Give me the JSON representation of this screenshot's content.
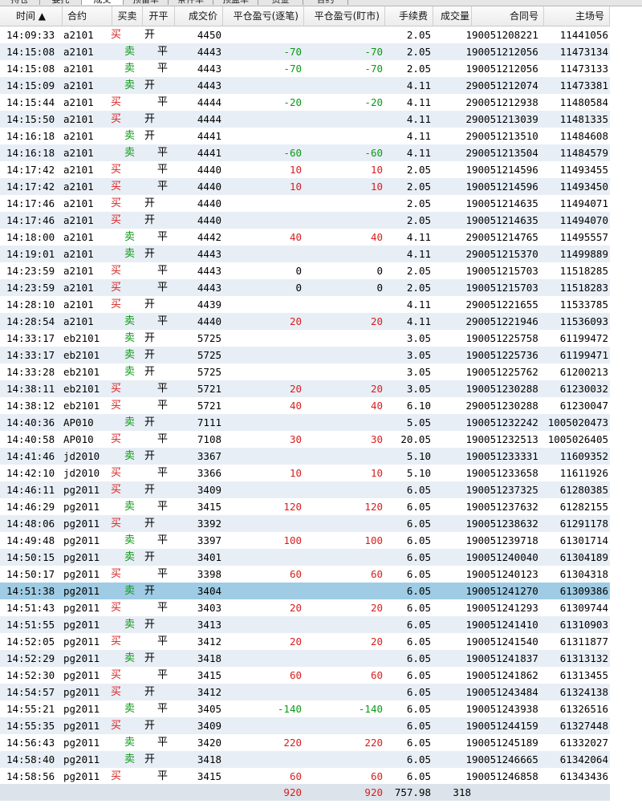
{
  "tabs": [
    "持仓",
    "委托",
    "成交",
    "预留单",
    "条件单",
    "预盈单",
    "资金",
    "合约"
  ],
  "active_tab": 2,
  "columns": {
    "time": "时间 ▲",
    "contract": "合约",
    "side": "买卖",
    "oc": "开平",
    "price": "成交价",
    "pnl_each": "平仓盈亏(逐笔)",
    "pnl_day": "平仓盈亏(盯市)",
    "fee": "手续费",
    "vol": "成交量",
    "order_no": "合同号",
    "deal_no": "主场号"
  },
  "rows": [
    {
      "time": "14:09:33",
      "contract": "a2101",
      "side": "买",
      "oc": "开",
      "price": "4450",
      "pnl_each": "",
      "pnl_day": "",
      "fee": "2.05",
      "vol": "1",
      "order_no": "90051208221",
      "deal_no": "11441056"
    },
    {
      "time": "14:15:08",
      "contract": "a2101",
      "side": "卖",
      "oc": "平",
      "price": "4443",
      "pnl_each": "-70",
      "pnl_day": "-70",
      "fee": "2.05",
      "vol": "1",
      "order_no": "90051212056",
      "deal_no": "11473134"
    },
    {
      "time": "14:15:08",
      "contract": "a2101",
      "side": "卖",
      "oc": "平",
      "price": "4443",
      "pnl_each": "-70",
      "pnl_day": "-70",
      "fee": "2.05",
      "vol": "1",
      "order_no": "90051212056",
      "deal_no": "11473133"
    },
    {
      "time": "14:15:09",
      "contract": "a2101",
      "side": "卖",
      "oc": "开",
      "price": "4443",
      "pnl_each": "",
      "pnl_day": "",
      "fee": "4.11",
      "vol": "2",
      "order_no": "90051212074",
      "deal_no": "11473381"
    },
    {
      "time": "14:15:44",
      "contract": "a2101",
      "side": "买",
      "oc": "平",
      "price": "4444",
      "pnl_each": "-20",
      "pnl_day": "-20",
      "fee": "4.11",
      "vol": "2",
      "order_no": "90051212938",
      "deal_no": "11480584"
    },
    {
      "time": "14:15:50",
      "contract": "a2101",
      "side": "买",
      "oc": "开",
      "price": "4444",
      "pnl_each": "",
      "pnl_day": "",
      "fee": "4.11",
      "vol": "2",
      "order_no": "90051213039",
      "deal_no": "11481335"
    },
    {
      "time": "14:16:18",
      "contract": "a2101",
      "side": "卖",
      "oc": "开",
      "price": "4441",
      "pnl_each": "",
      "pnl_day": "",
      "fee": "4.11",
      "vol": "2",
      "order_no": "90051213510",
      "deal_no": "11484608"
    },
    {
      "time": "14:16:18",
      "contract": "a2101",
      "side": "卖",
      "oc": "平",
      "price": "4441",
      "pnl_each": "-60",
      "pnl_day": "-60",
      "fee": "4.11",
      "vol": "2",
      "order_no": "90051213504",
      "deal_no": "11484579"
    },
    {
      "time": "14:17:42",
      "contract": "a2101",
      "side": "买",
      "oc": "平",
      "price": "4440",
      "pnl_each": "10",
      "pnl_day": "10",
      "fee": "2.05",
      "vol": "1",
      "order_no": "90051214596",
      "deal_no": "11493455"
    },
    {
      "time": "14:17:42",
      "contract": "a2101",
      "side": "买",
      "oc": "平",
      "price": "4440",
      "pnl_each": "10",
      "pnl_day": "10",
      "fee": "2.05",
      "vol": "1",
      "order_no": "90051214596",
      "deal_no": "11493450"
    },
    {
      "time": "14:17:46",
      "contract": "a2101",
      "side": "买",
      "oc": "开",
      "price": "4440",
      "pnl_each": "",
      "pnl_day": "",
      "fee": "2.05",
      "vol": "1",
      "order_no": "90051214635",
      "deal_no": "11494071"
    },
    {
      "time": "14:17:46",
      "contract": "a2101",
      "side": "买",
      "oc": "开",
      "price": "4440",
      "pnl_each": "",
      "pnl_day": "",
      "fee": "2.05",
      "vol": "1",
      "order_no": "90051214635",
      "deal_no": "11494070"
    },
    {
      "time": "14:18:00",
      "contract": "a2101",
      "side": "卖",
      "oc": "平",
      "price": "4442",
      "pnl_each": "40",
      "pnl_day": "40",
      "fee": "4.11",
      "vol": "2",
      "order_no": "90051214765",
      "deal_no": "11495557"
    },
    {
      "time": "14:19:01",
      "contract": "a2101",
      "side": "卖",
      "oc": "开",
      "price": "4443",
      "pnl_each": "",
      "pnl_day": "",
      "fee": "4.11",
      "vol": "2",
      "order_no": "90051215370",
      "deal_no": "11499889"
    },
    {
      "time": "14:23:59",
      "contract": "a2101",
      "side": "买",
      "oc": "平",
      "price": "4443",
      "pnl_each": "0",
      "pnl_day": "0",
      "fee": "2.05",
      "vol": "1",
      "order_no": "90051215703",
      "deal_no": "11518285"
    },
    {
      "time": "14:23:59",
      "contract": "a2101",
      "side": "买",
      "oc": "平",
      "price": "4443",
      "pnl_each": "0",
      "pnl_day": "0",
      "fee": "2.05",
      "vol": "1",
      "order_no": "90051215703",
      "deal_no": "11518283"
    },
    {
      "time": "14:28:10",
      "contract": "a2101",
      "side": "买",
      "oc": "开",
      "price": "4439",
      "pnl_each": "",
      "pnl_day": "",
      "fee": "4.11",
      "vol": "2",
      "order_no": "90051221655",
      "deal_no": "11533785"
    },
    {
      "time": "14:28:54",
      "contract": "a2101",
      "side": "卖",
      "oc": "平",
      "price": "4440",
      "pnl_each": "20",
      "pnl_day": "20",
      "fee": "4.11",
      "vol": "2",
      "order_no": "90051221946",
      "deal_no": "11536093"
    },
    {
      "time": "14:33:17",
      "contract": "eb2101",
      "side": "卖",
      "oc": "开",
      "price": "5725",
      "pnl_each": "",
      "pnl_day": "",
      "fee": "3.05",
      "vol": "1",
      "order_no": "90051225758",
      "deal_no": "61199472"
    },
    {
      "time": "14:33:17",
      "contract": "eb2101",
      "side": "卖",
      "oc": "开",
      "price": "5725",
      "pnl_each": "",
      "pnl_day": "",
      "fee": "3.05",
      "vol": "1",
      "order_no": "90051225736",
      "deal_no": "61199471"
    },
    {
      "time": "14:33:28",
      "contract": "eb2101",
      "side": "卖",
      "oc": "开",
      "price": "5725",
      "pnl_each": "",
      "pnl_day": "",
      "fee": "3.05",
      "vol": "1",
      "order_no": "90051225762",
      "deal_no": "61200213"
    },
    {
      "time": "14:38:11",
      "contract": "eb2101",
      "side": "买",
      "oc": "平",
      "price": "5721",
      "pnl_each": "20",
      "pnl_day": "20",
      "fee": "3.05",
      "vol": "1",
      "order_no": "90051230288",
      "deal_no": "61230032"
    },
    {
      "time": "14:38:12",
      "contract": "eb2101",
      "side": "买",
      "oc": "平",
      "price": "5721",
      "pnl_each": "40",
      "pnl_day": "40",
      "fee": "6.10",
      "vol": "2",
      "order_no": "90051230288",
      "deal_no": "61230047"
    },
    {
      "time": "14:40:36",
      "contract": "AP010",
      "side": "卖",
      "oc": "开",
      "price": "7111",
      "pnl_each": "",
      "pnl_day": "",
      "fee": "5.05",
      "vol": "1",
      "order_no": "90051232242",
      "deal_no": "1005020473"
    },
    {
      "time": "14:40:58",
      "contract": "AP010",
      "side": "买",
      "oc": "平",
      "price": "7108",
      "pnl_each": "30",
      "pnl_day": "30",
      "fee": "20.05",
      "vol": "1",
      "order_no": "90051232513",
      "deal_no": "1005026405"
    },
    {
      "time": "14:41:46",
      "contract": "jd2010",
      "side": "卖",
      "oc": "开",
      "price": "3367",
      "pnl_each": "",
      "pnl_day": "",
      "fee": "5.10",
      "vol": "1",
      "order_no": "90051233331",
      "deal_no": "11609352"
    },
    {
      "time": "14:42:10",
      "contract": "jd2010",
      "side": "买",
      "oc": "平",
      "price": "3366",
      "pnl_each": "10",
      "pnl_day": "10",
      "fee": "5.10",
      "vol": "1",
      "order_no": "90051233658",
      "deal_no": "11611926"
    },
    {
      "time": "14:46:11",
      "contract": "pg2011",
      "side": "买",
      "oc": "开",
      "price": "3409",
      "pnl_each": "",
      "pnl_day": "",
      "fee": "6.05",
      "vol": "1",
      "order_no": "90051237325",
      "deal_no": "61280385"
    },
    {
      "time": "14:46:29",
      "contract": "pg2011",
      "side": "卖",
      "oc": "平",
      "price": "3415",
      "pnl_each": "120",
      "pnl_day": "120",
      "fee": "6.05",
      "vol": "1",
      "order_no": "90051237632",
      "deal_no": "61282155"
    },
    {
      "time": "14:48:06",
      "contract": "pg2011",
      "side": "买",
      "oc": "开",
      "price": "3392",
      "pnl_each": "",
      "pnl_day": "",
      "fee": "6.05",
      "vol": "1",
      "order_no": "90051238632",
      "deal_no": "61291178"
    },
    {
      "time": "14:49:48",
      "contract": "pg2011",
      "side": "卖",
      "oc": "平",
      "price": "3397",
      "pnl_each": "100",
      "pnl_day": "100",
      "fee": "6.05",
      "vol": "1",
      "order_no": "90051239718",
      "deal_no": "61301714"
    },
    {
      "time": "14:50:15",
      "contract": "pg2011",
      "side": "卖",
      "oc": "开",
      "price": "3401",
      "pnl_each": "",
      "pnl_day": "",
      "fee": "6.05",
      "vol": "1",
      "order_no": "90051240040",
      "deal_no": "61304189"
    },
    {
      "time": "14:50:17",
      "contract": "pg2011",
      "side": "买",
      "oc": "平",
      "price": "3398",
      "pnl_each": "60",
      "pnl_day": "60",
      "fee": "6.05",
      "vol": "1",
      "order_no": "90051240123",
      "deal_no": "61304318"
    },
    {
      "time": "14:51:38",
      "contract": "pg2011",
      "side": "卖",
      "oc": "开",
      "price": "3404",
      "pnl_each": "",
      "pnl_day": "",
      "fee": "6.05",
      "vol": "1",
      "order_no": "90051241270",
      "deal_no": "61309386"
    },
    {
      "time": "14:51:43",
      "contract": "pg2011",
      "side": "买",
      "oc": "平",
      "price": "3403",
      "pnl_each": "20",
      "pnl_day": "20",
      "fee": "6.05",
      "vol": "1",
      "order_no": "90051241293",
      "deal_no": "61309744"
    },
    {
      "time": "14:51:55",
      "contract": "pg2011",
      "side": "卖",
      "oc": "开",
      "price": "3413",
      "pnl_each": "",
      "pnl_day": "",
      "fee": "6.05",
      "vol": "1",
      "order_no": "90051241410",
      "deal_no": "61310903"
    },
    {
      "time": "14:52:05",
      "contract": "pg2011",
      "side": "买",
      "oc": "平",
      "price": "3412",
      "pnl_each": "20",
      "pnl_day": "20",
      "fee": "6.05",
      "vol": "1",
      "order_no": "90051241540",
      "deal_no": "61311877"
    },
    {
      "time": "14:52:29",
      "contract": "pg2011",
      "side": "卖",
      "oc": "开",
      "price": "3418",
      "pnl_each": "",
      "pnl_day": "",
      "fee": "6.05",
      "vol": "1",
      "order_no": "90051241837",
      "deal_no": "61313132"
    },
    {
      "time": "14:52:30",
      "contract": "pg2011",
      "side": "买",
      "oc": "平",
      "price": "3415",
      "pnl_each": "60",
      "pnl_day": "60",
      "fee": "6.05",
      "vol": "1",
      "order_no": "90051241862",
      "deal_no": "61313455"
    },
    {
      "time": "14:54:57",
      "contract": "pg2011",
      "side": "买",
      "oc": "开",
      "price": "3412",
      "pnl_each": "",
      "pnl_day": "",
      "fee": "6.05",
      "vol": "1",
      "order_no": "90051243484",
      "deal_no": "61324138"
    },
    {
      "time": "14:55:21",
      "contract": "pg2011",
      "side": "卖",
      "oc": "平",
      "price": "3405",
      "pnl_each": "-140",
      "pnl_day": "-140",
      "fee": "6.05",
      "vol": "1",
      "order_no": "90051243938",
      "deal_no": "61326516"
    },
    {
      "time": "14:55:35",
      "contract": "pg2011",
      "side": "买",
      "oc": "开",
      "price": "3409",
      "pnl_each": "",
      "pnl_day": "",
      "fee": "6.05",
      "vol": "1",
      "order_no": "90051244159",
      "deal_no": "61327448"
    },
    {
      "time": "14:56:43",
      "contract": "pg2011",
      "side": "卖",
      "oc": "平",
      "price": "3420",
      "pnl_each": "220",
      "pnl_day": "220",
      "fee": "6.05",
      "vol": "1",
      "order_no": "90051245189",
      "deal_no": "61332027"
    },
    {
      "time": "14:58:40",
      "contract": "pg2011",
      "side": "卖",
      "oc": "开",
      "price": "3418",
      "pnl_each": "",
      "pnl_day": "",
      "fee": "6.05",
      "vol": "1",
      "order_no": "90051246665",
      "deal_no": "61342064"
    },
    {
      "time": "14:58:56",
      "contract": "pg2011",
      "side": "买",
      "oc": "平",
      "price": "3415",
      "pnl_each": "60",
      "pnl_day": "60",
      "fee": "6.05",
      "vol": "1",
      "order_no": "90051246858",
      "deal_no": "61343436"
    }
  ],
  "selected_row": 33,
  "summary": {
    "pnl_each": "920",
    "pnl_day": "920",
    "fee": "757.98",
    "vol": "318"
  },
  "colors": {
    "buy": "#d81e1e",
    "sell": "#0a9a14",
    "selected_row": "#9fcbe4",
    "alt_row": "#e8eef5"
  }
}
